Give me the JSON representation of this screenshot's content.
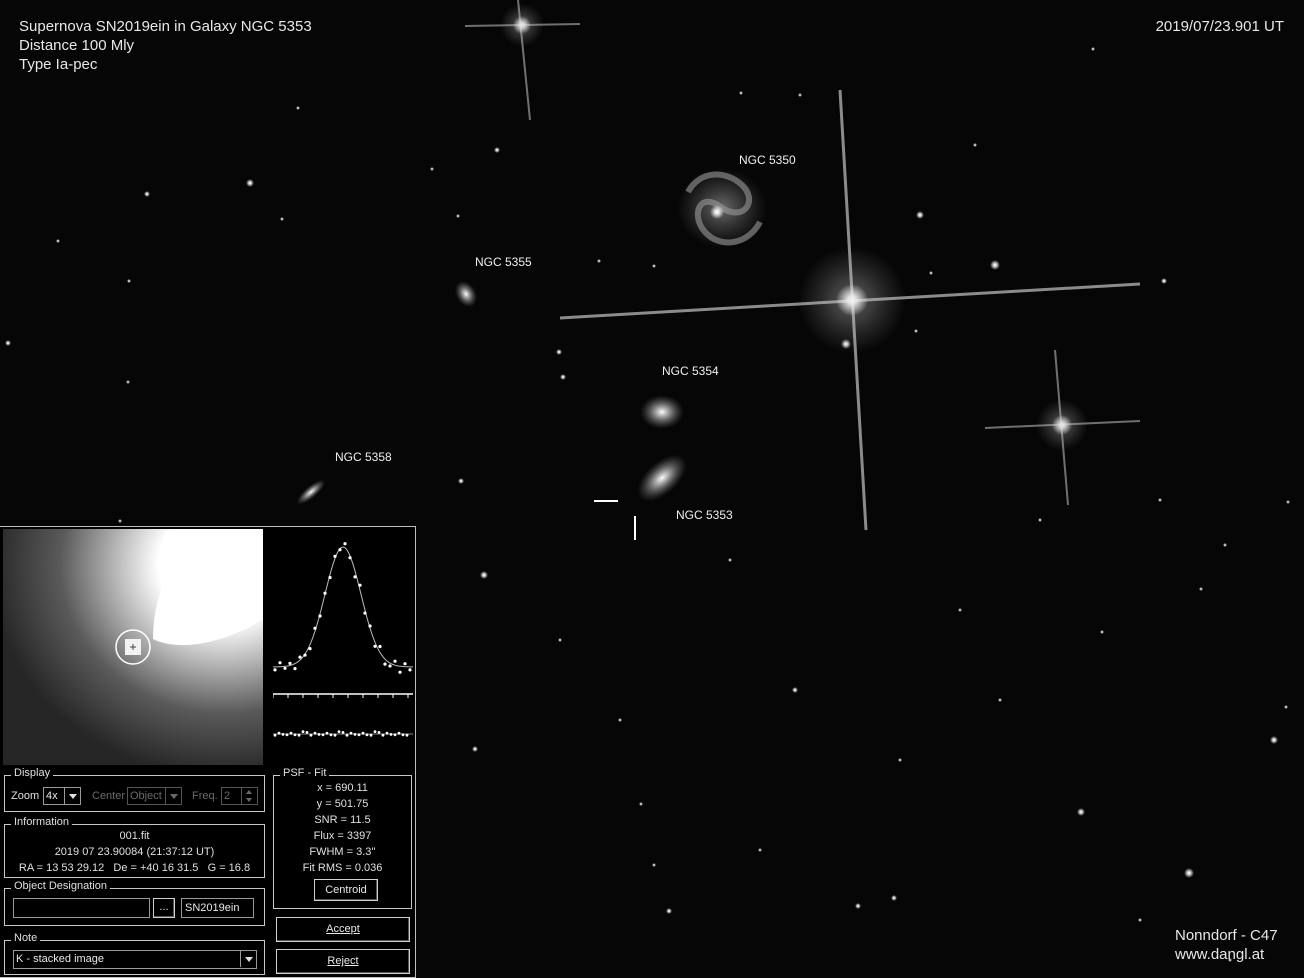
{
  "caption": {
    "title": "Supernova SN2019ein in Galaxy NGC 5353",
    "distance": "Distance 100 Mly",
    "type": "Type Ia-pec",
    "timestamp": "2019/07/23.901 UT",
    "credit_site": "Nonndorf - C47",
    "credit_url": "www.dangl.at"
  },
  "galaxy_labels": {
    "ngc5350": "NGC 5350",
    "ngc5355": "NGC 5355",
    "ngc5354": "NGC 5354",
    "ngc5358": "NGC 5358",
    "ngc5353": "NGC 5353"
  },
  "panel": {
    "display": {
      "title": "Display",
      "zoom_label": "Zoom",
      "zoom_value": "4x",
      "center_label": "Center",
      "center_value": "Object",
      "freq_label": "Freq.",
      "freq_value": "2"
    },
    "information": {
      "title": "Information",
      "file": "001.fit",
      "date": "2019 07 23.90084 (21:37:12 UT)",
      "coords": "RA = 13 53 29.12   De = +40 16 31.5   G = 16.8"
    },
    "object_designation": {
      "title": "Object Designation",
      "browse_label": "...",
      "value": "SN2019ein"
    },
    "note": {
      "title": "Note",
      "value": "K - stacked image"
    },
    "psf_fit": {
      "title": "PSF - Fit",
      "x": "x = 690.11",
      "y": "y = 501.75",
      "snr": "SNR = 11.5",
      "flux": "Flux = 3397",
      "fwhm": "FWHM = 3.3''",
      "fit_rms": "Fit RMS = 0.036",
      "centroid_label": "Centroid"
    },
    "accept_label": "Accept",
    "reject_label": "Reject"
  }
}
